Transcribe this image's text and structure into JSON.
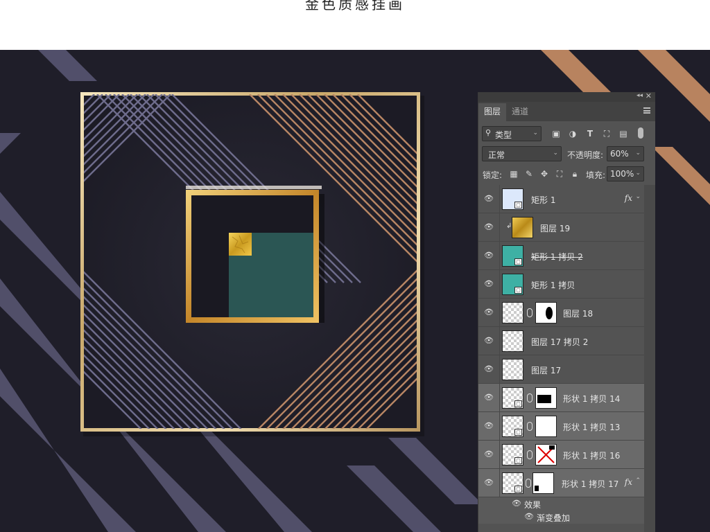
{
  "page": {
    "top_title": "金色质感挂画"
  },
  "panel": {
    "tabs": [
      "图层",
      "通道"
    ],
    "filter_label": "类型",
    "blend_mode": "正常",
    "opacity_label": "不透明度:",
    "opacity_value": "60%",
    "lock_label": "锁定:",
    "fill_label": "填充:",
    "fill_value": "100%",
    "layers": [
      {
        "name": "矩形 1",
        "thumb": "light-blue",
        "fx": "fx",
        "selected": false
      },
      {
        "name": "图层 19",
        "thumb": "gold",
        "clipped": true,
        "selected": false
      },
      {
        "name": "矩形 1 拷贝 2",
        "thumb": "teal",
        "strike": true,
        "selected": false
      },
      {
        "name": "矩形 1 拷贝",
        "thumb": "teal",
        "selected": false
      },
      {
        "name": "图层 18",
        "thumb": "checker-mask",
        "selected": false
      },
      {
        "name": "图层 17 拷贝 2",
        "thumb": "checker",
        "selected": false
      },
      {
        "name": "图层 17",
        "thumb": "checker",
        "selected": false
      },
      {
        "name": "形状 1 拷贝 14",
        "thumb": "shape-mask",
        "selected": true
      },
      {
        "name": "形状 1 拷贝 13",
        "thumb": "shape-mask",
        "selected": true
      },
      {
        "name": "形状 1 拷贝 16",
        "thumb": "shape-mask",
        "selected": true
      },
      {
        "name": "形状 1 拷贝 17",
        "thumb": "shape-mask",
        "fx": "fx",
        "selected": true
      }
    ],
    "effects_label": "效果",
    "effect_item": "渐变叠加"
  },
  "colors": {
    "background": "#1f1e29",
    "gold": "#d9b36a",
    "copper": "#b88664",
    "lavender": "#6e6c8c",
    "teal": "#2f5b58",
    "panel": "#535353"
  }
}
